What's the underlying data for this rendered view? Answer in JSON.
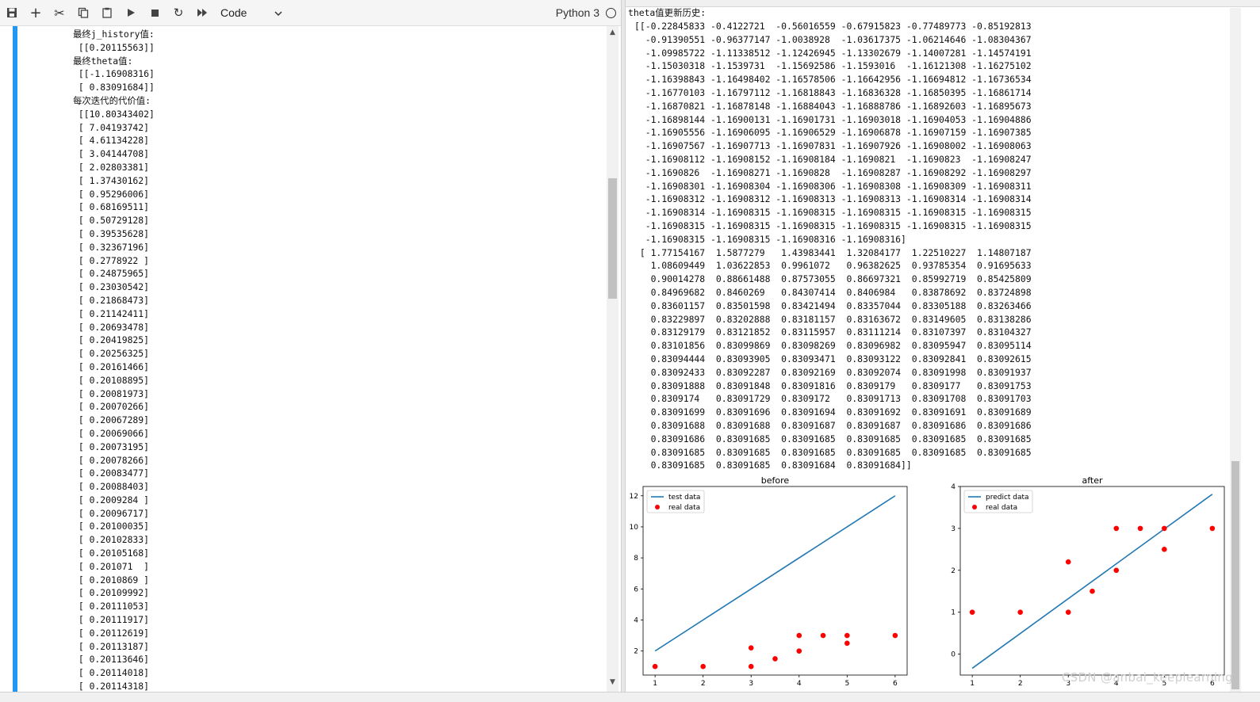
{
  "toolbar": {
    "cell_type": "Code",
    "kernel": "Python 3"
  },
  "left_output": {
    "lines": [
      "最终j_history值:",
      " [[0.20115563]]",
      "最终theta值:",
      " [[-1.16908316]",
      " [ 0.83091684]]",
      "每次迭代的代价值:",
      " [[10.80343402]",
      " [ 7.04193742]",
      " [ 4.61134228]",
      " [ 3.04144708]",
      " [ 2.02803381]",
      " [ 1.37430162]",
      " [ 0.95296006]",
      " [ 0.68169511]",
      " [ 0.50729128]",
      " [ 0.39535628]",
      " [ 0.32367196]",
      " [ 0.2778922 ]",
      " [ 0.24875965]",
      " [ 0.23030542]",
      " [ 0.21868473]",
      " [ 0.21142411]",
      " [ 0.20693478]",
      " [ 0.20419825]",
      " [ 0.20256325]",
      " [ 0.20161466]",
      " [ 0.20108895]",
      " [ 0.20081973]",
      " [ 0.20070266]",
      " [ 0.20067289]",
      " [ 0.20069066]",
      " [ 0.20073195]",
      " [ 0.20078266]",
      " [ 0.20083477]",
      " [ 0.20088403]",
      " [ 0.2009284 ]",
      " [ 0.20096717]",
      " [ 0.20100035]",
      " [ 0.20102833]",
      " [ 0.20105168]",
      " [ 0.201071  ]",
      " [ 0.2010869 ]",
      " [ 0.20109992]",
      " [ 0.20111053]",
      " [ 0.20111917]",
      " [ 0.20112619]",
      " [ 0.20113187]",
      " [ 0.20113646]",
      " [ 0.20114018]",
      " [ 0.20114318]"
    ]
  },
  "right_output": {
    "title": "theta值更新历史:",
    "lines": [
      "[[-0.22845833 -0.4122721  -0.56016559 -0.67915823 -0.77489773 -0.85192813",
      "  -0.91390551 -0.96377147 -1.0038928  -1.03617375 -1.06214646 -1.08304367",
      "  -1.09985722 -1.11338512 -1.12426945 -1.13302679 -1.14007281 -1.14574191",
      "  -1.15030318 -1.1539731  -1.15692586 -1.1593016  -1.16121308 -1.16275102",
      "  -1.16398843 -1.16498402 -1.16578506 -1.16642956 -1.16694812 -1.16736534",
      "  -1.16770103 -1.16797112 -1.16818843 -1.16836328 -1.16850395 -1.16861714",
      "  -1.16870821 -1.16878148 -1.16884043 -1.16888786 -1.16892603 -1.16895673",
      "  -1.16898144 -1.16900131 -1.16901731 -1.16903018 -1.16904053 -1.16904886",
      "  -1.16905556 -1.16906095 -1.16906529 -1.16906878 -1.16907159 -1.16907385",
      "  -1.16907567 -1.16907713 -1.16907831 -1.16907926 -1.16908002 -1.16908063",
      "  -1.16908112 -1.16908152 -1.16908184 -1.1690821  -1.1690823  -1.16908247",
      "  -1.1690826  -1.16908271 -1.1690828  -1.16908287 -1.16908292 -1.16908297",
      "  -1.16908301 -1.16908304 -1.16908306 -1.16908308 -1.16908309 -1.16908311",
      "  -1.16908312 -1.16908312 -1.16908313 -1.16908313 -1.16908314 -1.16908314",
      "  -1.16908314 -1.16908315 -1.16908315 -1.16908315 -1.16908315 -1.16908315",
      "  -1.16908315 -1.16908315 -1.16908315 -1.16908315 -1.16908315 -1.16908315",
      "  -1.16908315 -1.16908315 -1.16908316 -1.16908316]",
      " [ 1.77154167  1.5877279   1.43983441  1.32084177  1.22510227  1.14807187",
      "   1.08609449  1.03622853  0.9961072   0.96382625  0.93785354  0.91695633",
      "   0.90014278  0.88661488  0.87573055  0.86697321  0.85992719  0.85425809",
      "   0.84969682  0.8460269   0.84307414  0.8406984   0.83878692  0.83724898",
      "   0.83601157  0.83501598  0.83421494  0.83357044  0.83305188  0.83263466",
      "   0.83229897  0.83202888  0.83181157  0.83163672  0.83149605  0.83138286",
      "   0.83129179  0.83121852  0.83115957  0.83111214  0.83107397  0.83104327",
      "   0.83101856  0.83099869  0.83098269  0.83096982  0.83095947  0.83095114",
      "   0.83094444  0.83093905  0.83093471  0.83093122  0.83092841  0.83092615",
      "   0.83092433  0.83092287  0.83092169  0.83092074  0.83091998  0.83091937",
      "   0.83091888  0.83091848  0.83091816  0.8309179   0.8309177   0.83091753",
      "   0.8309174   0.83091729  0.8309172   0.83091713  0.83091708  0.83091703",
      "   0.83091699  0.83091696  0.83091694  0.83091692  0.83091691  0.83091689",
      "   0.83091688  0.83091688  0.83091687  0.83091687  0.83091686  0.83091686",
      "   0.83091686  0.83091685  0.83091685  0.83091685  0.83091685  0.83091685",
      "   0.83091685  0.83091685  0.83091685  0.83091685  0.83091685  0.83091685",
      "   0.83091685  0.83091685  0.83091684  0.83091684]]"
    ]
  },
  "chart_data": [
    {
      "type": "scatter",
      "title": "before",
      "xlim": [
        0.75,
        6.25
      ],
      "ylim": [
        0.45,
        12.6
      ],
      "xticks": [
        1,
        2,
        3,
        4,
        5,
        6
      ],
      "yticks": [
        2,
        4,
        6,
        8,
        10,
        12
      ],
      "legend": "top-left",
      "line": {
        "name": "test data",
        "color": "#1f77b4",
        "x": [
          1,
          6
        ],
        "y": [
          2,
          12
        ]
      },
      "points": {
        "name": "real data",
        "color": "#ff0000",
        "x": [
          1,
          2,
          3,
          3,
          3.5,
          4,
          4,
          4.5,
          5,
          5,
          6
        ],
        "y": [
          1,
          1,
          1,
          2.2,
          1.5,
          2,
          3,
          3,
          3,
          2.5,
          3
        ]
      }
    },
    {
      "type": "scatter",
      "title": "after",
      "xlim": [
        0.75,
        6.25
      ],
      "ylim": [
        -0.5,
        4.0
      ],
      "xticks": [
        1,
        2,
        3,
        4,
        5,
        6
      ],
      "yticks": [
        0,
        1,
        2,
        3,
        4
      ],
      "legend": "top-left",
      "line": {
        "name": "predict data",
        "color": "#1f77b4",
        "x": [
          1,
          6
        ],
        "y": [
          -0.338,
          3.816
        ]
      },
      "points": {
        "name": "real data",
        "color": "#ff0000",
        "x": [
          1,
          2,
          3,
          3,
          3.5,
          4,
          4,
          4.5,
          5,
          5,
          6
        ],
        "y": [
          1,
          1,
          1,
          2.2,
          1.5,
          2,
          3,
          3,
          3,
          2.5,
          3
        ]
      }
    }
  ],
  "watermark": "CSDN @anbai_keeplearning"
}
